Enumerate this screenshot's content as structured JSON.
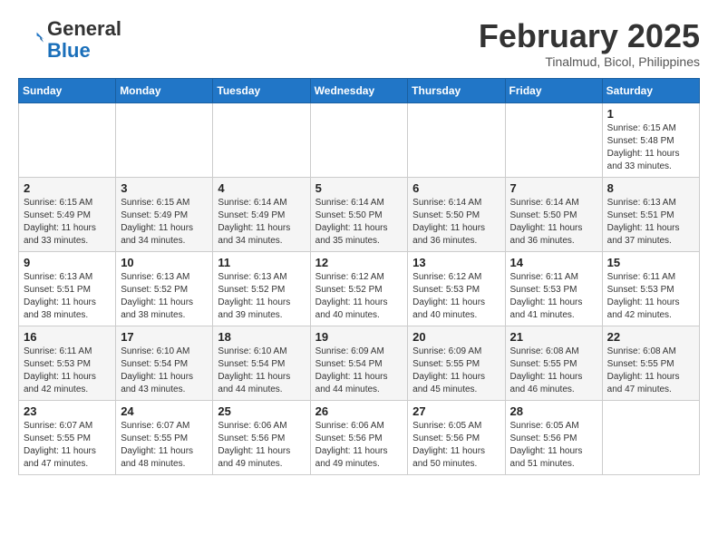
{
  "header": {
    "logo_general": "General",
    "logo_blue": "Blue",
    "month_year": "February 2025",
    "location": "Tinalmud, Bicol, Philippines"
  },
  "weekdays": [
    "Sunday",
    "Monday",
    "Tuesday",
    "Wednesday",
    "Thursday",
    "Friday",
    "Saturday"
  ],
  "weeks": [
    [
      {
        "day": "",
        "info": ""
      },
      {
        "day": "",
        "info": ""
      },
      {
        "day": "",
        "info": ""
      },
      {
        "day": "",
        "info": ""
      },
      {
        "day": "",
        "info": ""
      },
      {
        "day": "",
        "info": ""
      },
      {
        "day": "1",
        "info": "Sunrise: 6:15 AM\nSunset: 5:48 PM\nDaylight: 11 hours and 33 minutes."
      }
    ],
    [
      {
        "day": "2",
        "info": "Sunrise: 6:15 AM\nSunset: 5:49 PM\nDaylight: 11 hours and 33 minutes."
      },
      {
        "day": "3",
        "info": "Sunrise: 6:15 AM\nSunset: 5:49 PM\nDaylight: 11 hours and 34 minutes."
      },
      {
        "day": "4",
        "info": "Sunrise: 6:14 AM\nSunset: 5:49 PM\nDaylight: 11 hours and 34 minutes."
      },
      {
        "day": "5",
        "info": "Sunrise: 6:14 AM\nSunset: 5:50 PM\nDaylight: 11 hours and 35 minutes."
      },
      {
        "day": "6",
        "info": "Sunrise: 6:14 AM\nSunset: 5:50 PM\nDaylight: 11 hours and 36 minutes."
      },
      {
        "day": "7",
        "info": "Sunrise: 6:14 AM\nSunset: 5:50 PM\nDaylight: 11 hours and 36 minutes."
      },
      {
        "day": "8",
        "info": "Sunrise: 6:13 AM\nSunset: 5:51 PM\nDaylight: 11 hours and 37 minutes."
      }
    ],
    [
      {
        "day": "9",
        "info": "Sunrise: 6:13 AM\nSunset: 5:51 PM\nDaylight: 11 hours and 38 minutes."
      },
      {
        "day": "10",
        "info": "Sunrise: 6:13 AM\nSunset: 5:52 PM\nDaylight: 11 hours and 38 minutes."
      },
      {
        "day": "11",
        "info": "Sunrise: 6:13 AM\nSunset: 5:52 PM\nDaylight: 11 hours and 39 minutes."
      },
      {
        "day": "12",
        "info": "Sunrise: 6:12 AM\nSunset: 5:52 PM\nDaylight: 11 hours and 40 minutes."
      },
      {
        "day": "13",
        "info": "Sunrise: 6:12 AM\nSunset: 5:53 PM\nDaylight: 11 hours and 40 minutes."
      },
      {
        "day": "14",
        "info": "Sunrise: 6:11 AM\nSunset: 5:53 PM\nDaylight: 11 hours and 41 minutes."
      },
      {
        "day": "15",
        "info": "Sunrise: 6:11 AM\nSunset: 5:53 PM\nDaylight: 11 hours and 42 minutes."
      }
    ],
    [
      {
        "day": "16",
        "info": "Sunrise: 6:11 AM\nSunset: 5:53 PM\nDaylight: 11 hours and 42 minutes."
      },
      {
        "day": "17",
        "info": "Sunrise: 6:10 AM\nSunset: 5:54 PM\nDaylight: 11 hours and 43 minutes."
      },
      {
        "day": "18",
        "info": "Sunrise: 6:10 AM\nSunset: 5:54 PM\nDaylight: 11 hours and 44 minutes."
      },
      {
        "day": "19",
        "info": "Sunrise: 6:09 AM\nSunset: 5:54 PM\nDaylight: 11 hours and 44 minutes."
      },
      {
        "day": "20",
        "info": "Sunrise: 6:09 AM\nSunset: 5:55 PM\nDaylight: 11 hours and 45 minutes."
      },
      {
        "day": "21",
        "info": "Sunrise: 6:08 AM\nSunset: 5:55 PM\nDaylight: 11 hours and 46 minutes."
      },
      {
        "day": "22",
        "info": "Sunrise: 6:08 AM\nSunset: 5:55 PM\nDaylight: 11 hours and 47 minutes."
      }
    ],
    [
      {
        "day": "23",
        "info": "Sunrise: 6:07 AM\nSunset: 5:55 PM\nDaylight: 11 hours and 47 minutes."
      },
      {
        "day": "24",
        "info": "Sunrise: 6:07 AM\nSunset: 5:55 PM\nDaylight: 11 hours and 48 minutes."
      },
      {
        "day": "25",
        "info": "Sunrise: 6:06 AM\nSunset: 5:56 PM\nDaylight: 11 hours and 49 minutes."
      },
      {
        "day": "26",
        "info": "Sunrise: 6:06 AM\nSunset: 5:56 PM\nDaylight: 11 hours and 49 minutes."
      },
      {
        "day": "27",
        "info": "Sunrise: 6:05 AM\nSunset: 5:56 PM\nDaylight: 11 hours and 50 minutes."
      },
      {
        "day": "28",
        "info": "Sunrise: 6:05 AM\nSunset: 5:56 PM\nDaylight: 11 hours and 51 minutes."
      },
      {
        "day": "",
        "info": ""
      }
    ]
  ]
}
